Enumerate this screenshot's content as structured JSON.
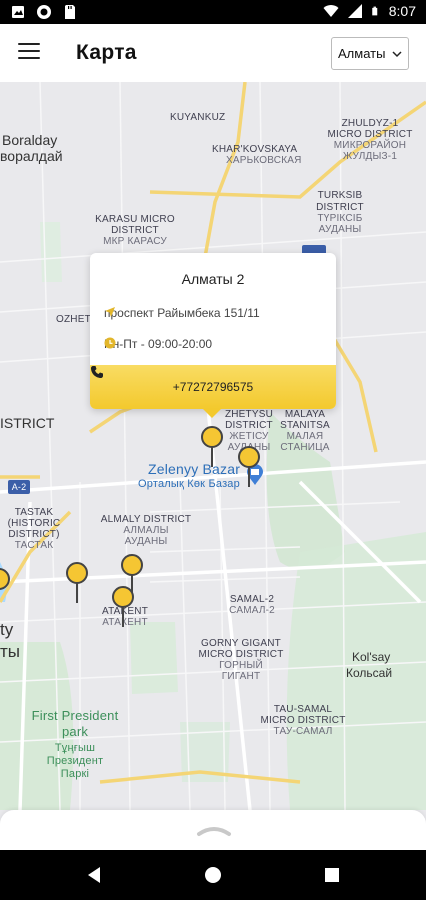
{
  "status_bar": {
    "time": "8:07",
    "left_icons": [
      "gallery-icon",
      "record-icon",
      "sd-card-icon"
    ],
    "right_icons": [
      "wifi-icon",
      "signal-icon",
      "battery-icon"
    ]
  },
  "header": {
    "title": "Карта",
    "city": "Алматы",
    "menu_icon": "hamburger-menu-icon"
  },
  "map": {
    "labels": {
      "kuyankuz": "KUYANKUZ",
      "boralday_en": "Boralday",
      "boralday_ru": "ворaлдай",
      "kharkovskaya_en": "KHAR'KOVSKAYA",
      "kharkovskaya_ru": "ХАРЬКОВСКАЯ",
      "zhuldyz_1": "ZHULDYZ-1",
      "zhuldyz_2": "MICRO DISTRICT",
      "zhuldyz_3": "МИКРОРАЙОН",
      "zhuldyz_4": "ЖУЛДЫЗ-1",
      "turksib_1": "TURKSIB",
      "turksib_2": "DISTRICT",
      "turksib_3": "ТҮРІКСІБ",
      "turksib_4": "АУДАНЫ",
      "karasu_1": "KARASU MICRO",
      "karasu_2": "DISTRICT",
      "karasu_3": "МКР КАРАСУ",
      "ozhet": "OZHET",
      "district_left": "ISTRICT",
      "malaya_1": "MALAYA",
      "malaya_2": "STANITSA",
      "malaya_3": "МАЛАЯ",
      "malaya_4": "СТАНИЦА",
      "zhetysu_1": "ZHETYSU",
      "zhetysu_2": "DISTRICT",
      "zhetysu_3": "ЖЕТІСУ",
      "zhetysu_4": "АУДАНЫ",
      "bazar_en": "Zelenyy Bazar",
      "bazar_kz": "Орталық Көк Базар",
      "a2": "A-2",
      "tastak_1": "TASTAK",
      "tastak_2": "(HISTORIC",
      "tastak_3": "DISTRICT)",
      "tastak_4": "ТАСТАК",
      "almaly_1": "ALMALY DISTRICT",
      "almaly_2": "АЛМАЛЫ",
      "almaly_3": "АУДАНЫ",
      "atakent_1": "ATAKENT",
      "atakent_2": "АТАКЕНТ",
      "samal_1": "SAMAL-2",
      "samal_2": "САМАЛ-2",
      "city_partial_1": "ty",
      "city_partial_2": "ты",
      "gorny_1": "GORNY GIGANT",
      "gorny_2": "MICRO DISTRICT",
      "gorny_3": "ГОРНЫЙ",
      "gorny_4": "ГИГАНТ",
      "kolsay_1": "Kol'say",
      "kolsay_2": "Кольсай",
      "tausamal_1": "TAU-SAMAL",
      "tausamal_2": "MICRO DISTRICT",
      "tausamal_3": "ТАУ-САМАЛ",
      "park_1": "First President",
      "park_2": "park",
      "park_3": "Тұңғыш",
      "park_4": "Президент",
      "park_5": "Паркі"
    },
    "pin_count": 6
  },
  "popup": {
    "title": "Алматы 2",
    "address": "проспект Райымбека 151/11",
    "hours": "Пн-Пт - 09:00-20:00",
    "phone": "+77272796575",
    "accent": "#f3c92d"
  },
  "bottom_sheet": {
    "handle_icon": "chevron-up-icon"
  },
  "nav": {
    "buttons": [
      "back-icon",
      "home-icon",
      "recents-icon"
    ]
  }
}
